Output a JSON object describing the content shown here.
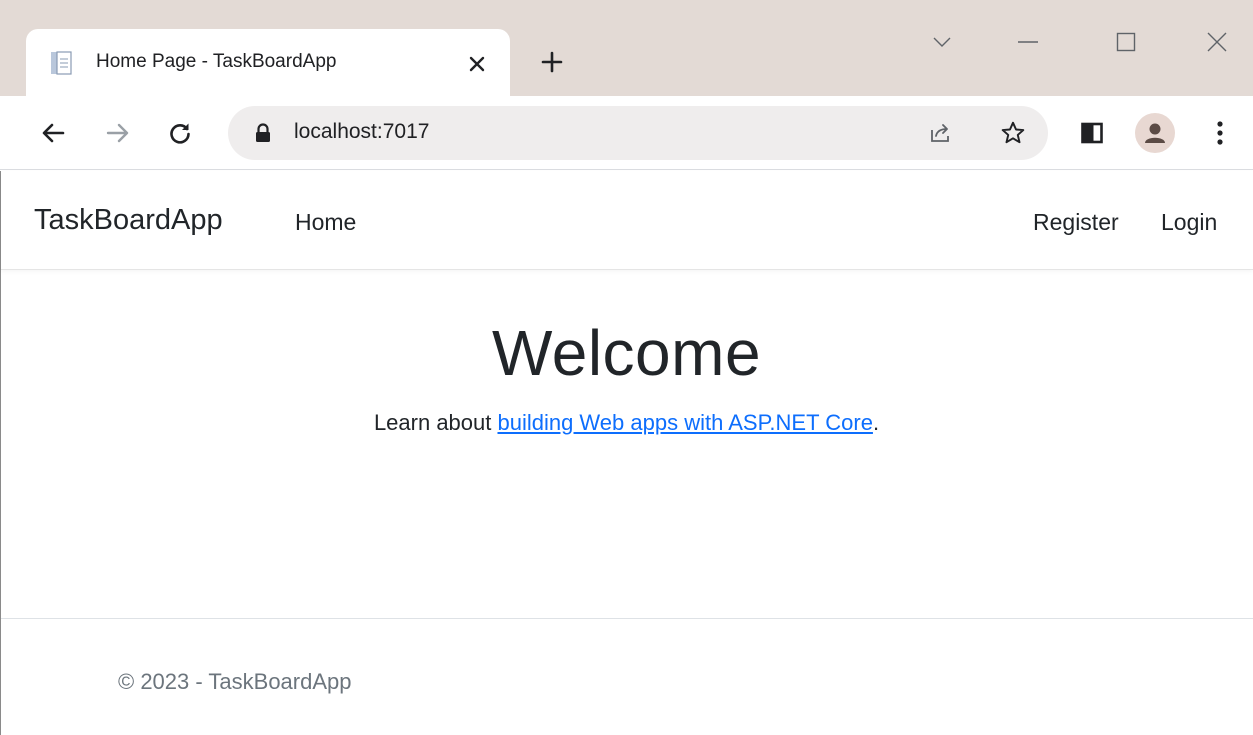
{
  "browser": {
    "tab": {
      "title": "Home Page - TaskBoardApp",
      "favicon": "document-icon"
    },
    "address": {
      "url": "localhost:7017"
    },
    "colors": {
      "tabstrip": "#e3dad5",
      "omnibox": "#efeded",
      "avatar": "#e8d8d2"
    }
  },
  "site": {
    "brand": "TaskBoardApp",
    "nav": {
      "home": "Home",
      "register": "Register",
      "login": "Login"
    },
    "main": {
      "heading": "Welcome",
      "learn_prefix": "Learn about ",
      "learn_link": "building Web apps with ASP.NET Core",
      "learn_suffix": "."
    },
    "footer": {
      "text": "© 2023 - TaskBoardApp"
    },
    "colors": {
      "link": "#0d6efd",
      "text": "#212529",
      "muted": "#6c757d"
    }
  }
}
